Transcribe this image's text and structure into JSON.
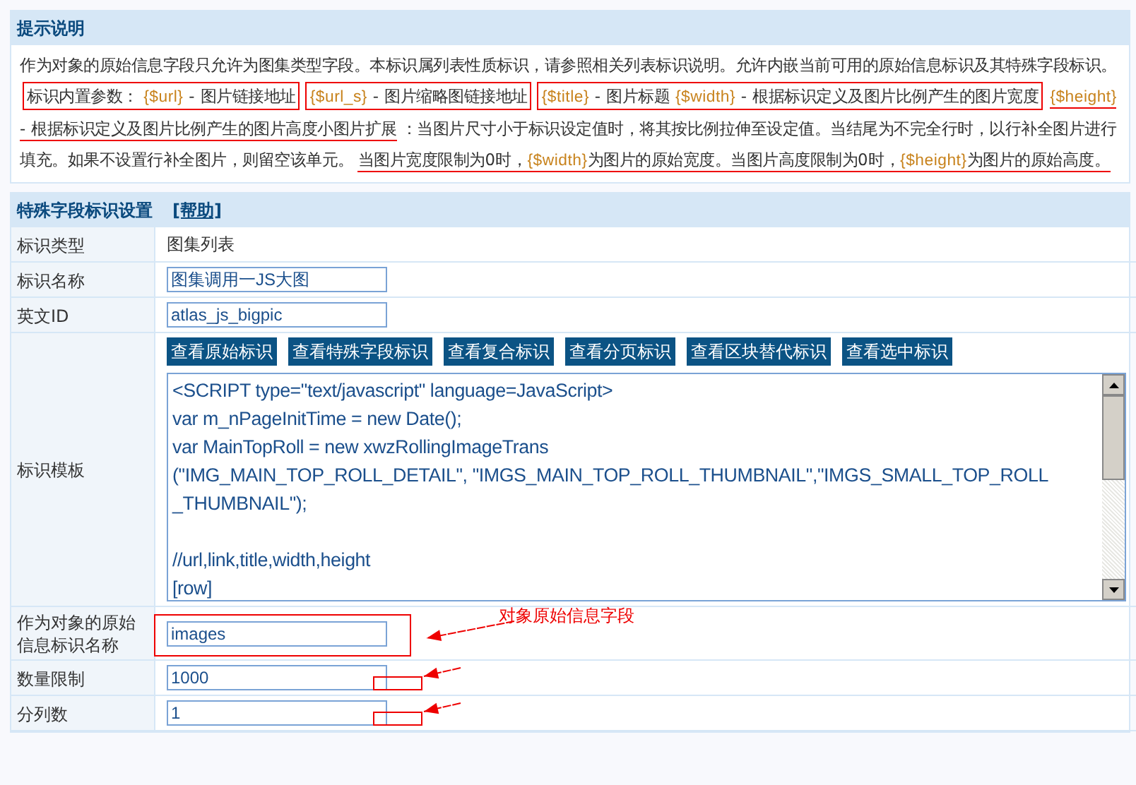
{
  "notice": {
    "title": "提示说明",
    "segments": [
      {
        "kind": "plain",
        "parts": [
          {
            "text": "作为对象的原始信息字段只允许为图集类型字段。本标识属列表性质标识，请参照相关列表标识说明。允许内嵌当前可用的原始信息标识及其特殊字段标识。",
            "token": false
          }
        ]
      },
      {
        "kind": "boxed",
        "parts": [
          {
            "text": "标识内置参数： ",
            "token": false
          },
          {
            "text": "{$url}",
            "token": true
          },
          {
            "text": " - 图片链接地址",
            "token": false
          }
        ]
      },
      {
        "kind": "boxed",
        "parts": [
          {
            "text": "{$url_s}",
            "token": true
          },
          {
            "text": " - 图片缩略图链接地址",
            "token": false
          }
        ]
      },
      {
        "kind": "boxed",
        "parts": [
          {
            "text": "{$title}",
            "token": true
          },
          {
            "text": " - 图片标题 ",
            "token": false
          },
          {
            "text": "{$width}",
            "token": true
          },
          {
            "text": " - 根据标识定义及图片比例产生的图片宽度",
            "token": false
          }
        ]
      },
      {
        "kind": "underlined",
        "parts": [
          {
            "text": "{$height}",
            "token": true
          },
          {
            "text": " - 根据标识定义及图片比例产生的图片高度小图片扩展",
            "token": false
          }
        ]
      },
      {
        "kind": "plain",
        "parts": [
          {
            "text": "：当图片尺寸小于标识设定值时，将其按比例拉伸至设定值。当结尾为不完全行时，以行补全图片进行填充。如果不设置行补全图片，则留空该单元。",
            "token": false
          }
        ]
      },
      {
        "kind": "underlined",
        "parts": [
          {
            "text": "当图片宽度限制为0时，",
            "token": false
          },
          {
            "text": "{$width}",
            "token": true
          },
          {
            "text": "为图片的原始宽度。当图片高度限制为0时，",
            "token": false
          },
          {
            "text": "{$height}",
            "token": true
          },
          {
            "text": "为图片的原始高度。",
            "token": false
          }
        ]
      }
    ]
  },
  "settings": {
    "title": "特殊字段标识设置",
    "help_link": "[帮助]",
    "rows": [
      {
        "kind": "text",
        "label": "标识类型",
        "value": "图集列表"
      },
      {
        "kind": "input",
        "label": "标识名称",
        "value": "图集调用一JS大图",
        "boxed": false,
        "arrow": false
      },
      {
        "kind": "input",
        "label": "英文ID",
        "value": "atlas_js_bigpic",
        "boxed": false,
        "arrow": false
      },
      {
        "kind": "template",
        "label": "标识模板",
        "buttons": [
          "查看原始标识",
          "查看特殊字段标识",
          "查看复合标识",
          "查看分页标识",
          "查看区块替代标识",
          "查看选中标识"
        ],
        "blocks": [
          [
            "<SCRIPT type=\"text/javascript\" language=JavaScript>",
            "var m_nPageInitTime = new Date();",
            "var MainTopRoll = new xwzRollingImageTrans",
            "(\"IMG_MAIN_TOP_ROLL_DETAIL\", \"IMGS_MAIN_TOP_ROLL_THUMBNAIL\",\"IMGS_SMALL_TOP_ROLL",
            "_THUMBNAIL\");"
          ],
          [
            "//url,link,title,width,height",
            "[row]"
          ]
        ]
      },
      {
        "kind": "input",
        "label": "作为对象的原始信息标识名称",
        "value": "images",
        "boxed": true,
        "arrow": true,
        "note": "对象原始信息字段"
      },
      {
        "kind": "input",
        "label": "数量限制",
        "value": "1000",
        "boxed": false,
        "arrow": true
      },
      {
        "kind": "input",
        "label": "分列数",
        "value": "1",
        "boxed": false,
        "arrow": true
      }
    ]
  }
}
